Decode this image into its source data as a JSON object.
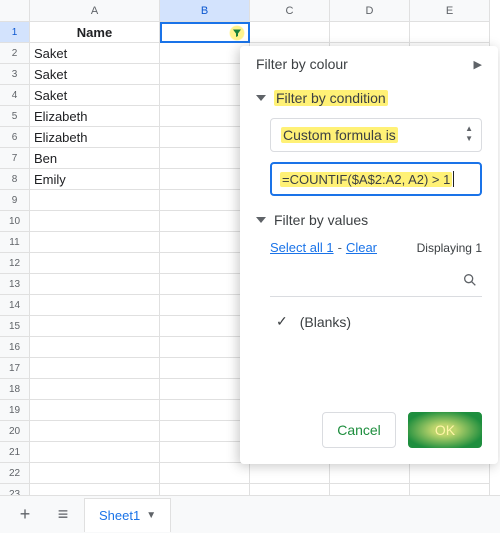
{
  "columns": [
    "A",
    "B",
    "C",
    "D",
    "E"
  ],
  "active_col_index": 1,
  "active_row_index": 0,
  "row_count": 23,
  "header_row": {
    "A": "Name",
    "B": ""
  },
  "data_rows": [
    "Saket",
    "Saket",
    "Saket",
    "Elizabeth",
    "Elizabeth",
    "Ben",
    "Emily"
  ],
  "filter": {
    "by_colour": "Filter by colour",
    "by_condition": "Filter by condition",
    "condition_type": "Custom formula is",
    "formula": "=COUNTIF($A$2:A2, A2) > 1",
    "by_values": "Filter by values",
    "select_all": "Select all 1",
    "clear": "Clear",
    "displaying": "Displaying 1",
    "blanks": "(Blanks)",
    "cancel": "Cancel",
    "ok": "OK"
  },
  "sheetbar": {
    "tab": "Sheet1"
  }
}
